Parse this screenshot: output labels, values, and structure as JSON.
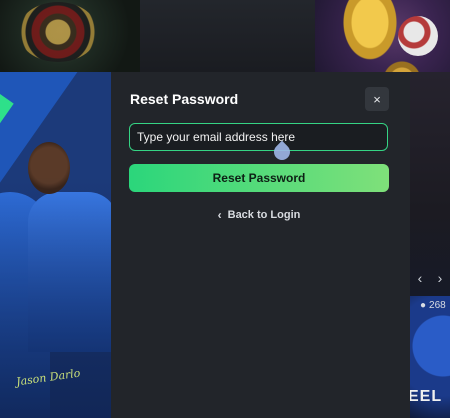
{
  "modal": {
    "title": "Reset Password",
    "close_icon": "×",
    "email": {
      "placeholder": "Type your email address here",
      "value": ""
    },
    "reset_button": "Reset Password",
    "back_link": "Back to Login",
    "back_icon": "‹"
  },
  "promo": {
    "signature": "Jason Darlo"
  },
  "background": {
    "wheel_count": "268",
    "wheel_label": "EEL",
    "nav_prev": "‹",
    "nav_next": "›"
  },
  "colors": {
    "accent": "#2bd67b",
    "modal_bg": "#22252a",
    "input_border": "#35d484"
  }
}
